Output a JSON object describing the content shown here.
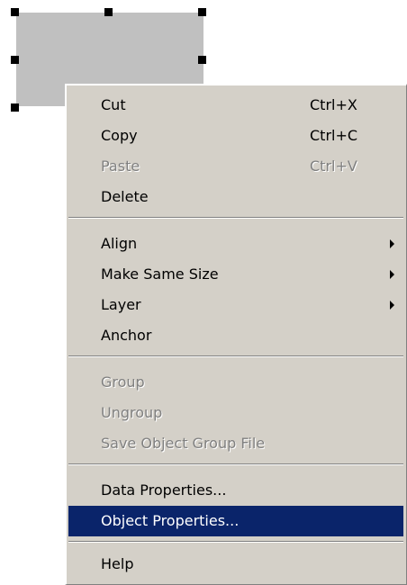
{
  "colors": {
    "menu_background": "#d4d0c8",
    "highlight": "#0a246a",
    "disabled_text": "#808080",
    "object_fill": "#c0c0c0"
  },
  "context_menu": {
    "items": [
      {
        "label": "Cut",
        "shortcut": "Ctrl+X",
        "enabled": true
      },
      {
        "label": "Copy",
        "shortcut": "Ctrl+C",
        "enabled": true
      },
      {
        "label": "Paste",
        "shortcut": "Ctrl+V",
        "enabled": false
      },
      {
        "label": "Delete",
        "enabled": true
      },
      {
        "label": "Align",
        "submenu": true,
        "enabled": true
      },
      {
        "label": "Make Same Size",
        "submenu": true,
        "enabled": true
      },
      {
        "label": "Layer",
        "submenu": true,
        "enabled": true
      },
      {
        "label": "Anchor",
        "enabled": true
      },
      {
        "label": "Group",
        "enabled": false
      },
      {
        "label": "Ungroup",
        "enabled": false
      },
      {
        "label": "Save Object Group File",
        "enabled": false
      },
      {
        "label": "Data Properties...",
        "enabled": true
      },
      {
        "label": "Object Properties...",
        "enabled": true,
        "selected": true
      },
      {
        "label": "Help",
        "enabled": true
      }
    ]
  }
}
